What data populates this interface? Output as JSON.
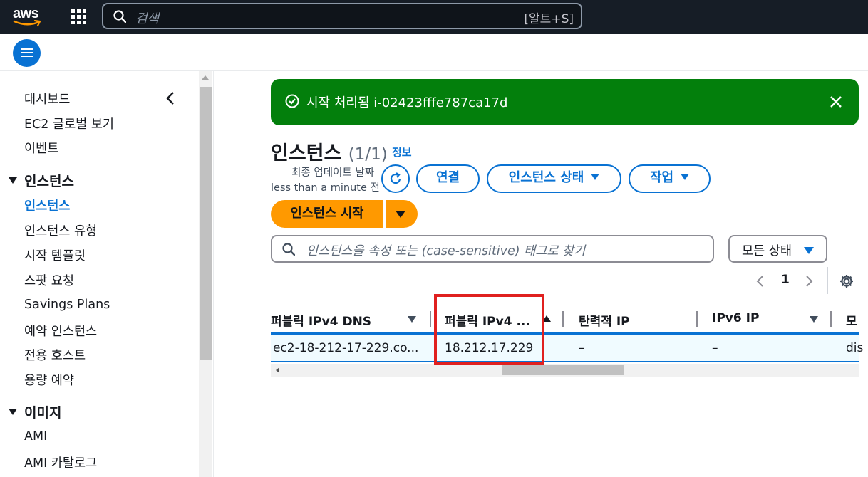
{
  "topbar": {
    "logo_text": "aws",
    "search_placeholder": "검색",
    "search_shortcut": "[알트+S]",
    "icons": [
      "apps-grid-icon",
      "search-icon"
    ]
  },
  "subbar": {
    "menu_icon": "hamburger-menu-icon"
  },
  "sidebar": {
    "items_top": [
      "대시보드",
      "EC2 글로벌 보기",
      "이벤트"
    ],
    "sections": [
      {
        "title": "인스턴스",
        "items": [
          "인스턴스",
          "인스턴스 유형",
          "시작 템플릿",
          "스팟 요청",
          "Savings Plans",
          "예약 인스턴스",
          "전용 호스트",
          "용량 예약"
        ],
        "active": "인스턴스"
      },
      {
        "title": "이미지",
        "items": [
          "AMI",
          "AMI 카탈로그"
        ]
      }
    ]
  },
  "flash": {
    "message": "시작 처리됨 i-02423fffe787ca17d",
    "color": "#037f0c"
  },
  "header": {
    "title": "인스턴스",
    "count": "(1/1)",
    "info_link": "정보",
    "updated_line1": "최종 업데이트 날짜",
    "updated_line2": "less than a minute 전"
  },
  "actions": {
    "connect": "연결",
    "instance_state": "인스턴스 상태",
    "actions": "작업",
    "launch": "인스턴스 시작"
  },
  "filter": {
    "placeholder": "인스턴스을 속성 또는 (case-sensitive) 태그로 찾기",
    "state_select": "모든 상태"
  },
  "pagination": {
    "page": "1"
  },
  "table": {
    "columns": [
      "퍼블릭 IPv4 DNS",
      "퍼블릭 IPv4 ...",
      "탄력적 IP",
      "IPv6 IP",
      "모"
    ],
    "rows": [
      [
        "ec2-18-212-17-229.co...",
        "18.212.17.229",
        "–",
        "–",
        "dis"
      ]
    ]
  },
  "colors": {
    "accent": "#0972d3",
    "primary_button": "#ff9900",
    "topbar": "#161d26",
    "highlight_box": "#e0201f"
  }
}
